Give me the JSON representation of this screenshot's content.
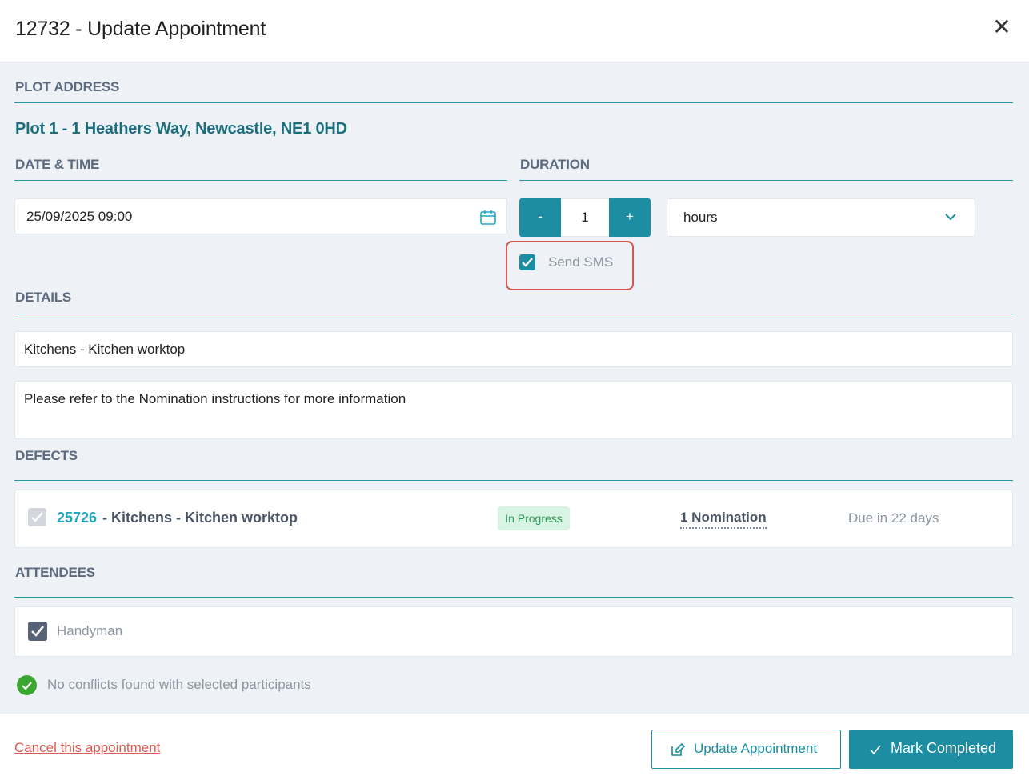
{
  "dialog": {
    "title": "12732 - Update Appointment",
    "close_glyph": "✕"
  },
  "plot_address": {
    "label": "PLOT ADDRESS",
    "value": "Plot 1 - 1 Heathers Way, Newcastle, NE1 0HD"
  },
  "date_time": {
    "label": "DATE & TIME",
    "value": "25/09/2025 09:00",
    "icon": "calendar-icon"
  },
  "duration": {
    "label": "DURATION",
    "decrement_label": "-",
    "value": "1",
    "increment_label": "+",
    "unit": "hours",
    "unit_icon": "chevron-down-icon"
  },
  "send_sms": {
    "label": "Send SMS",
    "checked": true
  },
  "details": {
    "label": "DETAILS",
    "title_value": "Kitchens - Kitchen worktop",
    "notes_value": "Please refer to the Nomination instructions for more information"
  },
  "defects": {
    "label": "DEFECTS",
    "items": [
      {
        "id": "25726",
        "title": "- Kitchens - Kitchen worktop",
        "status": "In Progress",
        "nominations": "1 Nomination",
        "due": "Due in 22 days",
        "checked": true,
        "disabled": true
      }
    ]
  },
  "attendees": {
    "label": "ATTENDEES",
    "items": [
      {
        "name": "Handyman",
        "checked": true
      }
    ]
  },
  "conflicts": {
    "text": "No conflicts found with selected participants",
    "icon": "check-circle-icon"
  },
  "footer": {
    "cancel_label": "Cancel this appointment",
    "update_label": "Update Appointment",
    "update_icon": "edit-icon",
    "complete_label": "Mark Completed",
    "complete_icon": "check-icon"
  },
  "colors": {
    "accent": "#1c8da2",
    "heading": "#1c6e7d",
    "danger": "#e05a52",
    "success": "#2f9a5c",
    "section_label": "#5c6b7e",
    "background": "#eef2f7"
  }
}
